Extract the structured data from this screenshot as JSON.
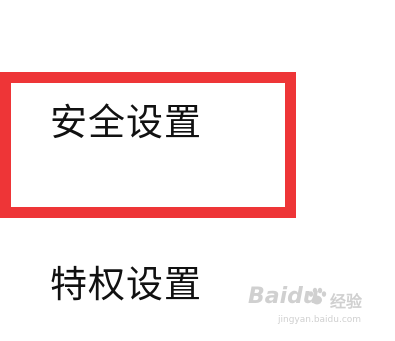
{
  "menu": {
    "items": [
      {
        "label": "安全设置",
        "highlighted": true
      },
      {
        "label": "特权设置",
        "highlighted": false
      }
    ]
  },
  "highlight": {
    "color": "#ee3537"
  },
  "watermark": {
    "brand": "Baidu",
    "jingyan": "经验",
    "url": "jingyan.baidu.com"
  }
}
